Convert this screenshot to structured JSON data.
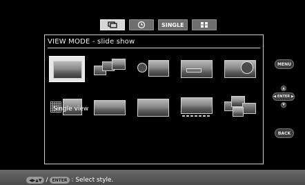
{
  "tabs": [
    {
      "icon": "slideshow-icon",
      "label": ""
    },
    {
      "icon": "clock-icon",
      "label": ""
    },
    {
      "icon": "",
      "label": "SINGLE"
    },
    {
      "icon": "index-grid-icon",
      "label": ""
    }
  ],
  "panel": {
    "title": "VIEW MODE - slide show",
    "selected_label": "Single view"
  },
  "side_buttons": {
    "menu": "MENU",
    "enter": "◀ ENTER ▶",
    "back": "BACK"
  },
  "footer": {
    "arrows": "◀▶▲▼",
    "separator": "/",
    "enter_key": "ENTER",
    "instruction": ": Select style."
  },
  "styles": [
    {
      "name": "single-view-style"
    },
    {
      "name": "multi-view-style"
    },
    {
      "name": "clock-small-style"
    },
    {
      "name": "calendar-style"
    },
    {
      "name": "clock-large-style"
    },
    {
      "name": "calendar-month-style"
    },
    {
      "name": "panorama-style"
    },
    {
      "name": "wide-view-style"
    },
    {
      "name": "date-strip-style"
    },
    {
      "name": "collage-style"
    }
  ]
}
